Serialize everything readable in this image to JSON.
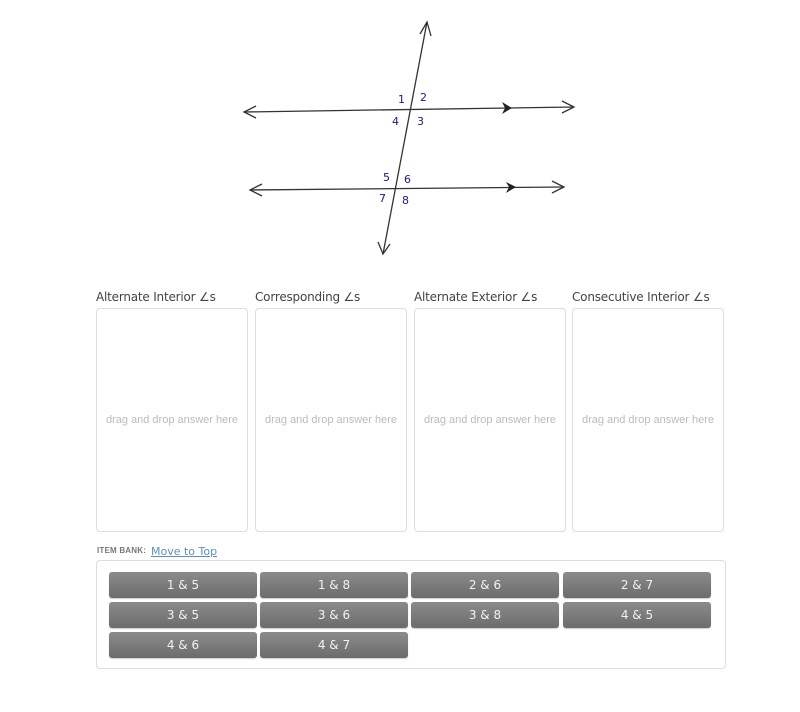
{
  "figure": {
    "angle_labels": [
      "1",
      "2",
      "3",
      "4",
      "5",
      "6",
      "7",
      "8"
    ],
    "label_color": "#1a1a8c"
  },
  "categories": [
    {
      "label": "Alternate Interior ∠s",
      "hint": "drag and drop answer here"
    },
    {
      "label": "Corresponding ∠s",
      "hint": "drag and drop answer here"
    },
    {
      "label": "Alternate Exterior ∠s",
      "hint": "drag and drop answer here"
    },
    {
      "label": "Consecutive Interior ∠s",
      "hint": "drag and drop answer here"
    }
  ],
  "item_bank": {
    "label": "ITEM BANK:",
    "move_to_top": "Move to Top",
    "items": [
      "1 & 5",
      "1 & 8",
      "2 & 6",
      "2 & 7",
      "3 & 5",
      "3 & 6",
      "3 & 8",
      "4 & 5",
      "4 & 6",
      "4 & 7"
    ]
  }
}
